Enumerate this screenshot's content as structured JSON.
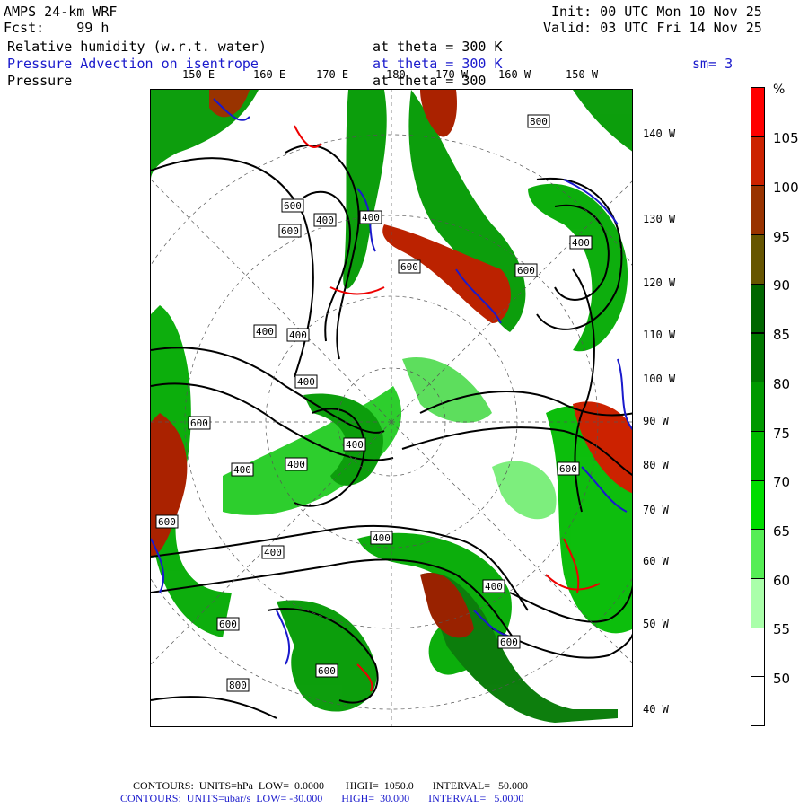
{
  "header": {
    "model": "AMPS 24-km WRF",
    "fcst_label": "Fcst:",
    "fcst_value": "99 h",
    "init": "Init: 00 UTC Mon 10 Nov 25",
    "valid": "Valid: 03 UTC Fri 14 Nov 25",
    "field1": "Relative humidity (w.r.t. water)",
    "field1_level": "at theta = 300 K",
    "field2": "Pressure Advection on isentrope",
    "field2_level": "at theta = 300 K",
    "smoothing": "sm= 3",
    "field3": "Pressure",
    "field3_level": "at theta = 300"
  },
  "axes": {
    "top_lon": [
      "150 E",
      "160 E",
      "170 E",
      "180",
      "170 W",
      "160 W",
      "150 W"
    ],
    "right_lon": [
      "140 W",
      "130 W",
      "120 W",
      "110 W",
      "100 W",
      "90 W",
      "80 W",
      "70 W",
      "60 W",
      "50 W",
      "40 W"
    ]
  },
  "legend": {
    "unit": "%",
    "labels": [
      "105",
      "100",
      "95",
      "90",
      "85",
      "80",
      "75",
      "70",
      "65",
      "60",
      "55",
      "50"
    ],
    "colors": [
      "#ff0000",
      "#cc2200",
      "#993300",
      "#665500",
      "#006600",
      "#007700",
      "#009900",
      "#00bb00",
      "#00dd00",
      "#55ee55",
      "#aaffaa",
      "#ffffff",
      "#ffffff"
    ]
  },
  "contour_labels": [
    "600",
    "600",
    "400",
    "400",
    "400",
    "400",
    "400",
    "600",
    "800",
    "600",
    "400",
    "600",
    "400",
    "400",
    "400",
    "600",
    "600",
    "600",
    "800",
    "600",
    "400",
    "400",
    "600",
    "400"
  ],
  "footer": {
    "line1": "CONTOURS:  UNITS=hPa  LOW=  0.0000        HIGH=  1050.0       INTERVAL=   50.000",
    "line2": "CONTOURS:  UNITS=ubar/s  LOW= -30.000       HIGH=  30.000       INTERVAL=   5.0000"
  },
  "colors": {
    "advection_positive": "#1a1acc",
    "advection_negative": "#ee0000",
    "pressure_contour": "#000000"
  }
}
